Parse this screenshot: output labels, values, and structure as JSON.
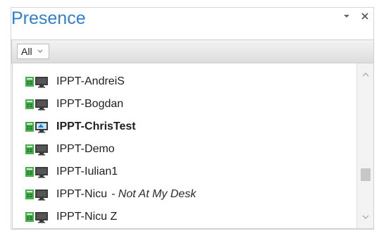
{
  "panel": {
    "title": "Presence"
  },
  "filter": {
    "selected": "All"
  },
  "items": [
    {
      "name": "IPPT-AndreiS",
      "icon": "phone-computer-icon",
      "bold": false,
      "note": ""
    },
    {
      "name": "IPPT-Bogdan",
      "icon": "phone-computer-icon",
      "bold": false,
      "note": ""
    },
    {
      "name": "IPPT-ChrisTest",
      "icon": "phone-computer-ca-icon",
      "bold": true,
      "note": ""
    },
    {
      "name": "IPPT-Demo",
      "icon": "phone-computer-icon",
      "bold": false,
      "note": ""
    },
    {
      "name": "IPPT-Iulian1",
      "icon": "phone-computer-icon",
      "bold": false,
      "note": ""
    },
    {
      "name": "IPPT-Nicu",
      "icon": "phone-computer-icon",
      "bold": false,
      "note": "- Not At My Desk"
    },
    {
      "name": "IPPT-Nicu Z",
      "icon": "phone-computer-icon",
      "bold": false,
      "note": ""
    }
  ],
  "colors": {
    "title": "#2f7fd3",
    "status_green": "#43b04a"
  }
}
